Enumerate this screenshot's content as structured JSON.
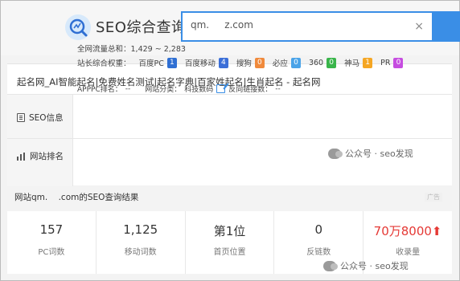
{
  "header": {
    "logo_text": "SEO综合查询",
    "search_value": "qm.     z.com",
    "clear_icon": "×"
  },
  "site": {
    "title": "起名网_AI智能起名|免费姓名测试|起名字典|百家姓起名|生肖起名 - 起名网"
  },
  "seo_info": {
    "label": "SEO信息",
    "traffic_label": "全网流量总和：",
    "traffic_value": "1,429 ~ 2,283",
    "weights_label": "站长综合权重：",
    "weights": [
      {
        "name": "百度PC",
        "value": "1",
        "color": "#2f6fd3"
      },
      {
        "name": "百度移动",
        "value": "4",
        "color": "#3b6fd8"
      },
      {
        "name": "搜狗",
        "value": "0",
        "color": "#f08a3c"
      },
      {
        "name": "必应",
        "value": "0",
        "color": "#4aa3e8"
      },
      {
        "name": "360",
        "value": "0",
        "color": "#39b54a"
      },
      {
        "name": "神马",
        "value": "1",
        "color": "#f5a623"
      },
      {
        "name": "PR",
        "value": "0",
        "color": "#c64de0"
      }
    ]
  },
  "site_rank": {
    "label": "网站排名",
    "appppc_label": "APPPC排名：",
    "appppc_value": "--",
    "category_label": "网站分类：",
    "category_value": "科技数码",
    "backlink_label": "反向链接数：",
    "backlink_value": "--"
  },
  "result": {
    "title": "网站qm.    .com的SEO查询结果",
    "ad_label": "广告",
    "stats": [
      {
        "value": "157",
        "label": "PC词数"
      },
      {
        "value": "1,125",
        "label": "移动词数"
      },
      {
        "value": "第1位",
        "label": "首页位置"
      },
      {
        "value": "0",
        "label": "反链数"
      },
      {
        "value": "70万8000⬆",
        "label": "收录量"
      }
    ]
  },
  "watermark": {
    "text": "公众号 · seo发现"
  }
}
